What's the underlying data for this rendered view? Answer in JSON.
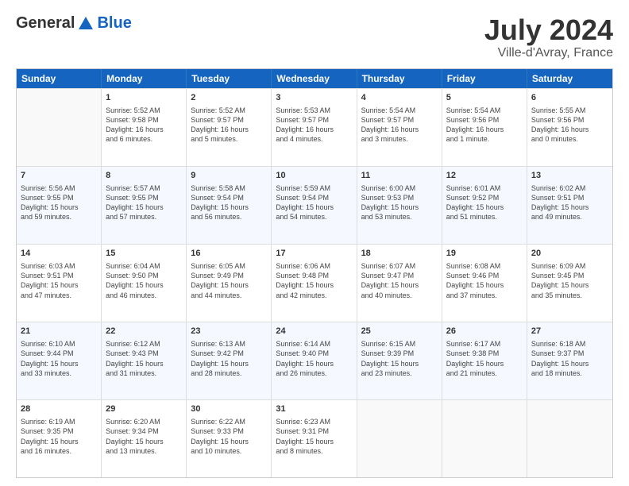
{
  "header": {
    "logo_general": "General",
    "logo_blue": "Blue",
    "month_title": "July 2024",
    "location": "Ville-d'Avray, France"
  },
  "weekdays": [
    "Sunday",
    "Monday",
    "Tuesday",
    "Wednesday",
    "Thursday",
    "Friday",
    "Saturday"
  ],
  "weeks": [
    [
      {
        "num": "",
        "info": ""
      },
      {
        "num": "1",
        "info": "Sunrise: 5:52 AM\nSunset: 9:58 PM\nDaylight: 16 hours\nand 6 minutes."
      },
      {
        "num": "2",
        "info": "Sunrise: 5:52 AM\nSunset: 9:57 PM\nDaylight: 16 hours\nand 5 minutes."
      },
      {
        "num": "3",
        "info": "Sunrise: 5:53 AM\nSunset: 9:57 PM\nDaylight: 16 hours\nand 4 minutes."
      },
      {
        "num": "4",
        "info": "Sunrise: 5:54 AM\nSunset: 9:57 PM\nDaylight: 16 hours\nand 3 minutes."
      },
      {
        "num": "5",
        "info": "Sunrise: 5:54 AM\nSunset: 9:56 PM\nDaylight: 16 hours\nand 1 minute."
      },
      {
        "num": "6",
        "info": "Sunrise: 5:55 AM\nSunset: 9:56 PM\nDaylight: 16 hours\nand 0 minutes."
      }
    ],
    [
      {
        "num": "7",
        "info": "Sunrise: 5:56 AM\nSunset: 9:55 PM\nDaylight: 15 hours\nand 59 minutes."
      },
      {
        "num": "8",
        "info": "Sunrise: 5:57 AM\nSunset: 9:55 PM\nDaylight: 15 hours\nand 57 minutes."
      },
      {
        "num": "9",
        "info": "Sunrise: 5:58 AM\nSunset: 9:54 PM\nDaylight: 15 hours\nand 56 minutes."
      },
      {
        "num": "10",
        "info": "Sunrise: 5:59 AM\nSunset: 9:54 PM\nDaylight: 15 hours\nand 54 minutes."
      },
      {
        "num": "11",
        "info": "Sunrise: 6:00 AM\nSunset: 9:53 PM\nDaylight: 15 hours\nand 53 minutes."
      },
      {
        "num": "12",
        "info": "Sunrise: 6:01 AM\nSunset: 9:52 PM\nDaylight: 15 hours\nand 51 minutes."
      },
      {
        "num": "13",
        "info": "Sunrise: 6:02 AM\nSunset: 9:51 PM\nDaylight: 15 hours\nand 49 minutes."
      }
    ],
    [
      {
        "num": "14",
        "info": "Sunrise: 6:03 AM\nSunset: 9:51 PM\nDaylight: 15 hours\nand 47 minutes."
      },
      {
        "num": "15",
        "info": "Sunrise: 6:04 AM\nSunset: 9:50 PM\nDaylight: 15 hours\nand 46 minutes."
      },
      {
        "num": "16",
        "info": "Sunrise: 6:05 AM\nSunset: 9:49 PM\nDaylight: 15 hours\nand 44 minutes."
      },
      {
        "num": "17",
        "info": "Sunrise: 6:06 AM\nSunset: 9:48 PM\nDaylight: 15 hours\nand 42 minutes."
      },
      {
        "num": "18",
        "info": "Sunrise: 6:07 AM\nSunset: 9:47 PM\nDaylight: 15 hours\nand 40 minutes."
      },
      {
        "num": "19",
        "info": "Sunrise: 6:08 AM\nSunset: 9:46 PM\nDaylight: 15 hours\nand 37 minutes."
      },
      {
        "num": "20",
        "info": "Sunrise: 6:09 AM\nSunset: 9:45 PM\nDaylight: 15 hours\nand 35 minutes."
      }
    ],
    [
      {
        "num": "21",
        "info": "Sunrise: 6:10 AM\nSunset: 9:44 PM\nDaylight: 15 hours\nand 33 minutes."
      },
      {
        "num": "22",
        "info": "Sunrise: 6:12 AM\nSunset: 9:43 PM\nDaylight: 15 hours\nand 31 minutes."
      },
      {
        "num": "23",
        "info": "Sunrise: 6:13 AM\nSunset: 9:42 PM\nDaylight: 15 hours\nand 28 minutes."
      },
      {
        "num": "24",
        "info": "Sunrise: 6:14 AM\nSunset: 9:40 PM\nDaylight: 15 hours\nand 26 minutes."
      },
      {
        "num": "25",
        "info": "Sunrise: 6:15 AM\nSunset: 9:39 PM\nDaylight: 15 hours\nand 23 minutes."
      },
      {
        "num": "26",
        "info": "Sunrise: 6:17 AM\nSunset: 9:38 PM\nDaylight: 15 hours\nand 21 minutes."
      },
      {
        "num": "27",
        "info": "Sunrise: 6:18 AM\nSunset: 9:37 PM\nDaylight: 15 hours\nand 18 minutes."
      }
    ],
    [
      {
        "num": "28",
        "info": "Sunrise: 6:19 AM\nSunset: 9:35 PM\nDaylight: 15 hours\nand 16 minutes."
      },
      {
        "num": "29",
        "info": "Sunrise: 6:20 AM\nSunset: 9:34 PM\nDaylight: 15 hours\nand 13 minutes."
      },
      {
        "num": "30",
        "info": "Sunrise: 6:22 AM\nSunset: 9:33 PM\nDaylight: 15 hours\nand 10 minutes."
      },
      {
        "num": "31",
        "info": "Sunrise: 6:23 AM\nSunset: 9:31 PM\nDaylight: 15 hours\nand 8 minutes."
      },
      {
        "num": "",
        "info": ""
      },
      {
        "num": "",
        "info": ""
      },
      {
        "num": "",
        "info": ""
      }
    ]
  ]
}
